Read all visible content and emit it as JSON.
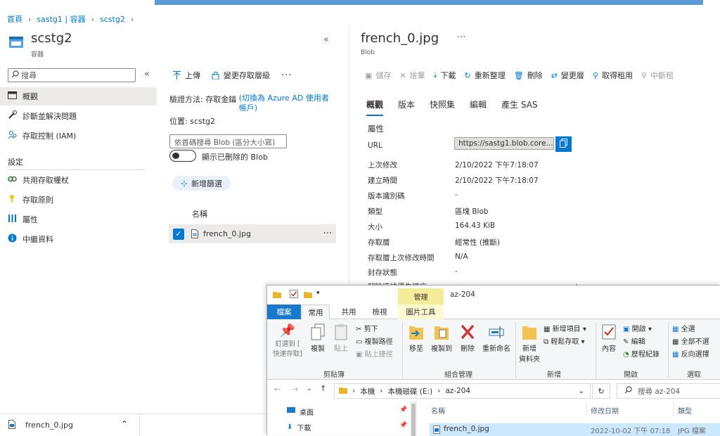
{
  "breadcrumb": [
    "首頁",
    "sastg1 | 容器",
    "scstg2"
  ],
  "left": {
    "title": "scstg2",
    "subtitle": "容器",
    "search_placeholder": "搜尋",
    "nav": [
      "概觀",
      "診斷並解決問題",
      "存取控制 (IAM)"
    ],
    "section": "設定",
    "settings": [
      "共用存取權杖",
      "存取原則",
      "屬性",
      "中繼資料"
    ]
  },
  "middle": {
    "toolbar": [
      "上傳",
      "變更存取層級"
    ],
    "auth_label": "驗證方法:",
    "auth_value": "存取金鑰",
    "auth_link": "(切換為 Azure AD 使用者帳戶)",
    "location_label": "位置:",
    "location_value": "scstg2",
    "search_placeholder": "依首碼搜尋 Blob (區分大小寫)",
    "toggle_label": "顯示已刪除的 Blob",
    "add_filter": "新增篩選",
    "col_name": "名稱",
    "file": "french_0.jpg"
  },
  "right": {
    "title": "french_0.jpg",
    "subtitle": "Blob",
    "toolbar": [
      "儲存",
      "捨棄",
      "下載",
      "重新整理",
      "刪除",
      "變更層",
      "取得租用",
      "中斷租"
    ],
    "tabs": [
      "概觀",
      "版本",
      "快照集",
      "編輯",
      "產生 SAS"
    ],
    "section": "屬性",
    "url_label": "URL",
    "url_value": "https://sastg1.blob.core...",
    "props": [
      {
        "label": "上次修改",
        "value": "2/10/2022 下午7:18:07"
      },
      {
        "label": "建立時間",
        "value": "2/10/2022 下午7:18:07"
      },
      {
        "label": "版本識別碼",
        "value": "-"
      },
      {
        "label": "類型",
        "value": "區塊 Blob"
      },
      {
        "label": "大小",
        "value": "164.43 KiB"
      },
      {
        "label": "存取層",
        "value": "經常性 (推斷)"
      },
      {
        "label": "存取層上次修改時間",
        "value": "N/A"
      },
      {
        "label": "封存狀態",
        "value": "-"
      },
      {
        "label": "解除凍結優先順序",
        "value": ""
      }
    ]
  },
  "download_bar": {
    "file": "french_0.jpg"
  },
  "explorer": {
    "manage_tab": "管理",
    "folder_title": "az-204",
    "tabs": [
      "檔案",
      "常用",
      "共用",
      "檢視",
      "圖片工具"
    ],
    "ribbon": {
      "pin": "釘選到 [\n快速存取]",
      "copy": "複製",
      "paste": "貼上",
      "cut": "剪下",
      "copy_path": "複製路徑",
      "paste_shortcut": "貼上捷徑",
      "clipboard": "剪貼簿",
      "move_to": "移至",
      "copy_to": "複製到",
      "delete": "刪除",
      "rename": "重新命名",
      "organize": "組合管理",
      "new_folder": "新增\n資料夾",
      "new_item": "新增項目",
      "easy_access": "輕鬆存取",
      "new": "新增",
      "properties": "內容",
      "open": "開啟",
      "edit": "編輯",
      "history": "歷程紀錄",
      "open_group": "開啟",
      "select_all": "全選",
      "select_none": "全部不選",
      "invert": "反向選擇",
      "select_group": "選取"
    },
    "path": [
      "本機",
      "本機磁碟 (E:)",
      "az-204"
    ],
    "search_placeholder": "搜尋 az-204",
    "nav": [
      "桌面",
      "下載"
    ],
    "columns": [
      "名稱",
      "修改日期",
      "類型"
    ],
    "file": {
      "name": "french_0.jpg",
      "date": "2022-10-02 下午 07:18",
      "type": "JPG 檔案"
    }
  }
}
